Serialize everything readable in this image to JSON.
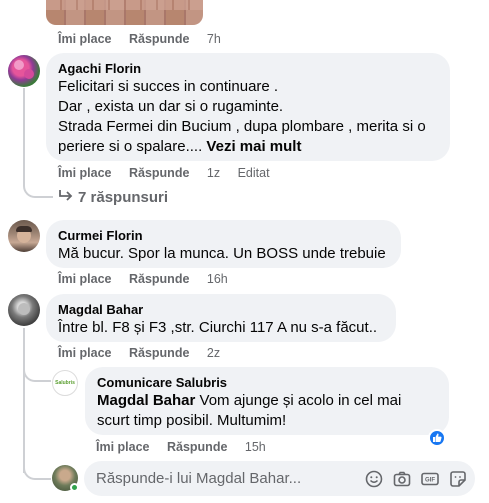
{
  "top_image": {
    "alt": ""
  },
  "top_actions": {
    "like": "Îmi place",
    "reply": "Răspunde",
    "time": "7h"
  },
  "comments": [
    {
      "author": "Agachi Florin",
      "lines": [
        "Felicitari si succes in continuare .",
        "Dar , exista un dar si o rugaminte.",
        "Strada Fermei din Bucium , dupa plombare , merita si o",
        "periere si o spalare...."
      ],
      "see_more": "Vezi mai mult",
      "like": "Îmi place",
      "reply": "Răspunde",
      "time": "1z",
      "edited": "Editat",
      "replies_link": "7 răspunsuri"
    },
    {
      "author": "Curmei Florin",
      "text": "Mă bucur. Spor la munca. Un BOSS unde trebuie",
      "like": "Îmi place",
      "reply": "Răspunde",
      "time": "16h"
    },
    {
      "author": "Magdal Bahar",
      "text": "Între bl. F8 și F3 ,str. Ciurchi 117 A nu s-a făcut..",
      "like": "Îmi place",
      "reply": "Răspunde",
      "time": "2z"
    }
  ],
  "nested_reply": {
    "author": "Comunicare Salubris",
    "mention": "Magdal Bahar",
    "text_first": " Vom ajunge și acolo in cel mai",
    "text_second": "scurt timp posibil. Multumim!",
    "like": "Îmi place",
    "reply": "Răspunde",
    "time": "15h",
    "reaction_icon": "like-thumb-icon",
    "avatar_logo_text": "Salubris"
  },
  "reply_input": {
    "placeholder": "Răspunde-i lui Magdal Bahar...",
    "icons": [
      "emoji-icon",
      "camera-icon",
      "gif-icon",
      "sticker-icon"
    ]
  },
  "colors": {
    "bubble": "#f0f2f5",
    "meta_text": "#65676b",
    "like_blue": "#1877f2",
    "online_green": "#31a24c"
  }
}
